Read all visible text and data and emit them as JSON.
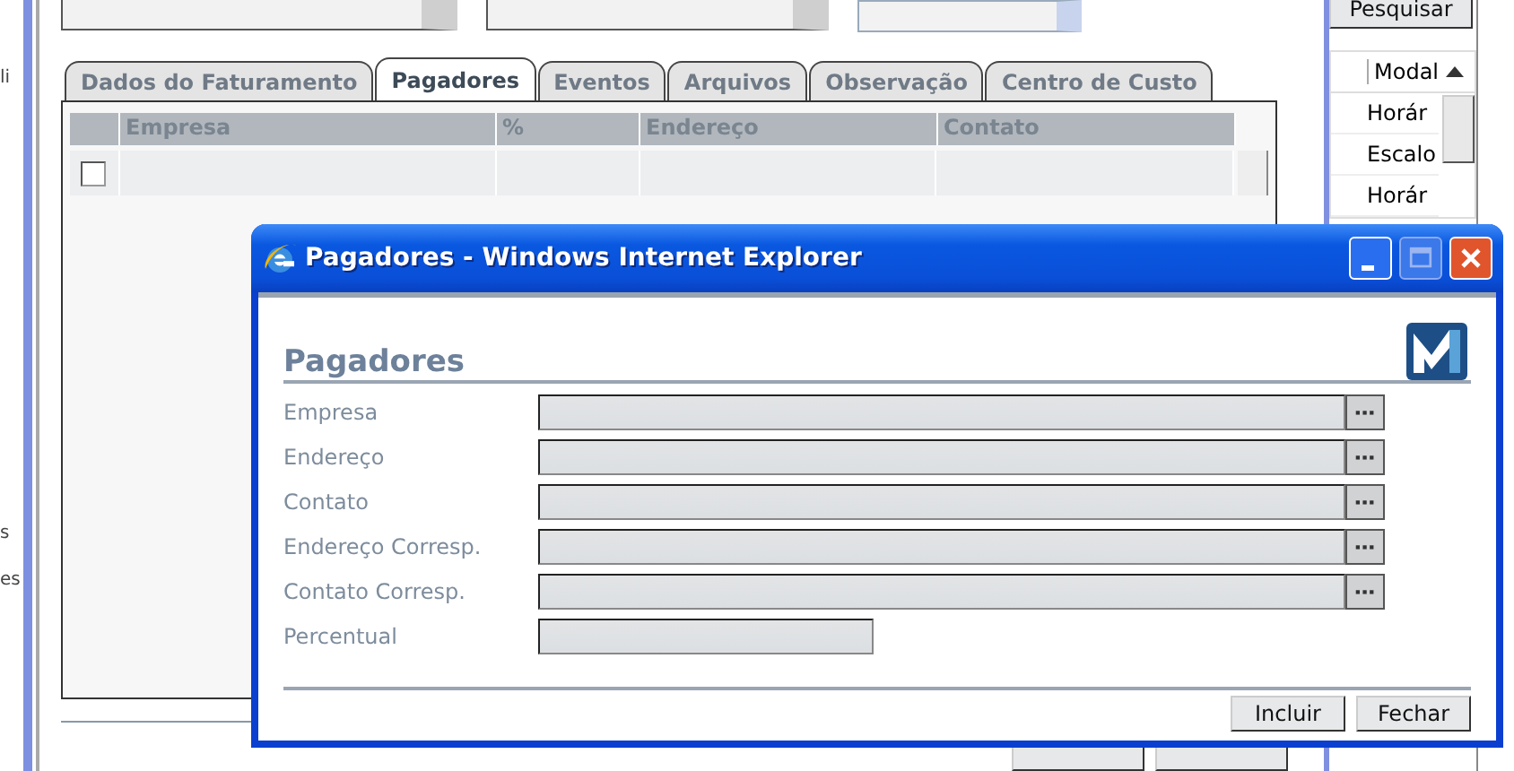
{
  "background": {
    "left_fragments": [
      "li",
      "s",
      "es"
    ],
    "tabs": [
      {
        "label": "Dados do Faturamento",
        "selected": false
      },
      {
        "label": "Pagadores",
        "selected": true
      },
      {
        "label": "Eventos",
        "selected": false
      },
      {
        "label": "Arquivos",
        "selected": false
      },
      {
        "label": "Observação",
        "selected": false
      },
      {
        "label": "Centro de Custo",
        "selected": false
      }
    ],
    "grid": {
      "columns": [
        "Empresa",
        "%",
        "Endereço",
        "Contato"
      ],
      "rows": [
        {
          "checked": false
        }
      ]
    },
    "search_button": "Pesquisar",
    "side_list": {
      "column": "Modal",
      "rows": [
        "Horár",
        "Escalo",
        "Horár"
      ]
    }
  },
  "dialog": {
    "title": "Pagadores - Windows Internet Explorer",
    "heading": "Pagadores",
    "fields": [
      {
        "label": "Empresa",
        "kind": "lookup"
      },
      {
        "label": "Endereço",
        "kind": "lookup"
      },
      {
        "label": "Contato",
        "kind": "lookup"
      },
      {
        "label": "Endereço Corresp.",
        "kind": "lookup"
      },
      {
        "label": "Contato Corresp.",
        "kind": "lookup"
      },
      {
        "label": "Percentual",
        "kind": "short"
      }
    ],
    "buttons": [
      "Incluir",
      "Fechar"
    ]
  }
}
